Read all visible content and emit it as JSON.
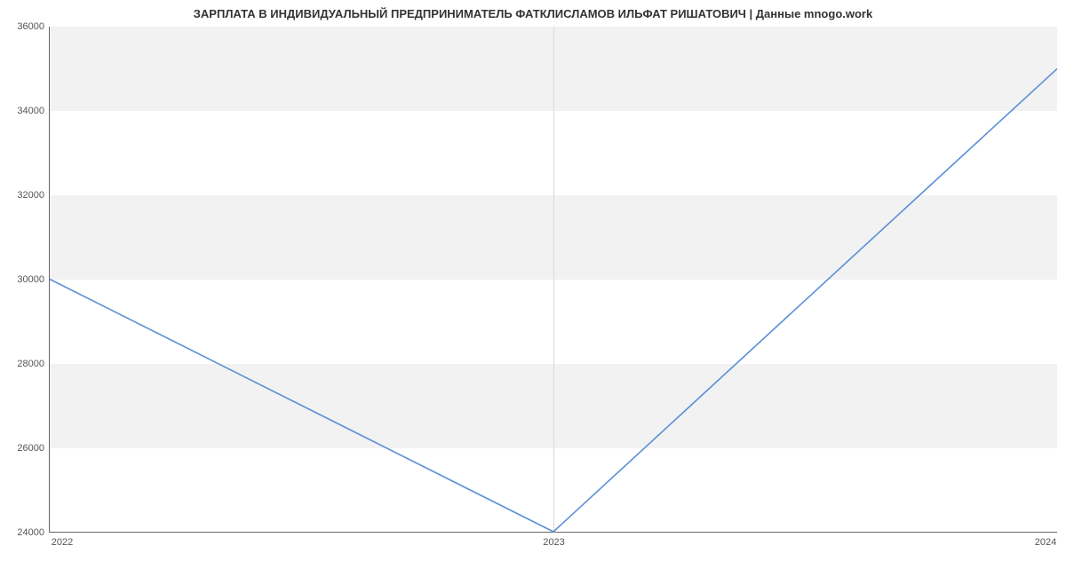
{
  "chart_data": {
    "type": "line",
    "title": "ЗАРПЛАТА В ИНДИВИДУАЛЬНЫЙ ПРЕДПРИНИМАТЕЛЬ ФАТКЛИСЛАМОВ ИЛЬФАТ РИШАТОВИЧ | Данные mnogo.work",
    "xlabel": "",
    "ylabel": "",
    "categories": [
      "2022",
      "2023",
      "2024"
    ],
    "x": [
      2022,
      2023,
      2024
    ],
    "values": [
      30000,
      24000,
      35000
    ],
    "xlim": [
      2022,
      2024
    ],
    "ylim": [
      24000,
      36000
    ],
    "yticks": [
      24000,
      26000,
      28000,
      30000,
      32000,
      34000,
      36000
    ]
  }
}
